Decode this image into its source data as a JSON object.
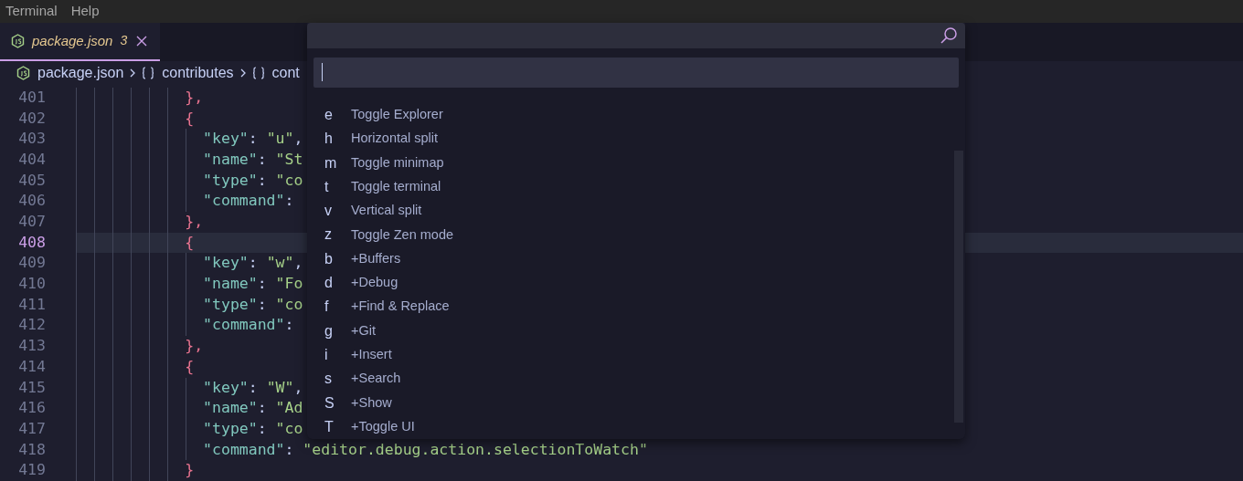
{
  "menu_bar": [
    "Terminal",
    "Help"
  ],
  "tabs": [
    {
      "label": "package.json",
      "badge": "3",
      "selected": true
    }
  ],
  "breadcrumb": [
    "package.json",
    "contributes",
    "cont"
  ],
  "code_lines": [
    {
      "number": "401",
      "selected": false,
      "tokens": [
        {
          "text": "            },",
          "kind": "punct"
        }
      ]
    },
    {
      "number": "402",
      "selected": false,
      "tokens": [
        {
          "text": "            {",
          "kind": "punct"
        }
      ]
    },
    {
      "number": "403",
      "selected": false,
      "tokens": [
        {
          "text": "              \"key\"",
          "kind": "key"
        },
        {
          "text": ": ",
          "kind": "plain"
        },
        {
          "text": "\"u\"",
          "kind": "string"
        },
        {
          "text": ",",
          "kind": "plain"
        }
      ]
    },
    {
      "number": "404",
      "selected": false,
      "tokens": [
        {
          "text": "              \"name\"",
          "kind": "key"
        },
        {
          "text": ": ",
          "kind": "plain"
        },
        {
          "text": "\"St",
          "kind": "string"
        }
      ]
    },
    {
      "number": "405",
      "selected": false,
      "tokens": [
        {
          "text": "              \"type\"",
          "kind": "key"
        },
        {
          "text": ": ",
          "kind": "plain"
        },
        {
          "text": "\"co",
          "kind": "string"
        }
      ]
    },
    {
      "number": "406",
      "selected": false,
      "tokens": [
        {
          "text": "              \"command\"",
          "kind": "key"
        },
        {
          "text": ":",
          "kind": "plain"
        }
      ]
    },
    {
      "number": "407",
      "selected": false,
      "tokens": [
        {
          "text": "            },",
          "kind": "punct"
        }
      ]
    },
    {
      "number": "408",
      "selected": true,
      "tokens": [
        {
          "text": "            {",
          "kind": "punct"
        }
      ]
    },
    {
      "number": "409",
      "selected": false,
      "tokens": [
        {
          "text": "              \"key\"",
          "kind": "key"
        },
        {
          "text": ": ",
          "kind": "plain"
        },
        {
          "text": "\"w\"",
          "kind": "string"
        },
        {
          "text": ",",
          "kind": "plain"
        }
      ]
    },
    {
      "number": "410",
      "selected": false,
      "tokens": [
        {
          "text": "              \"name\"",
          "kind": "key"
        },
        {
          "text": ": ",
          "kind": "plain"
        },
        {
          "text": "\"Fo",
          "kind": "string"
        }
      ]
    },
    {
      "number": "411",
      "selected": false,
      "tokens": [
        {
          "text": "              \"type\"",
          "kind": "key"
        },
        {
          "text": ": ",
          "kind": "plain"
        },
        {
          "text": "\"co",
          "kind": "string"
        }
      ]
    },
    {
      "number": "412",
      "selected": false,
      "tokens": [
        {
          "text": "              \"command\"",
          "kind": "key"
        },
        {
          "text": ":",
          "kind": "plain"
        }
      ]
    },
    {
      "number": "413",
      "selected": false,
      "tokens": [
        {
          "text": "            },",
          "kind": "punct"
        }
      ]
    },
    {
      "number": "414",
      "selected": false,
      "tokens": [
        {
          "text": "            {",
          "kind": "punct"
        }
      ]
    },
    {
      "number": "415",
      "selected": false,
      "tokens": [
        {
          "text": "              \"key\"",
          "kind": "key"
        },
        {
          "text": ": ",
          "kind": "plain"
        },
        {
          "text": "\"W\"",
          "kind": "string"
        },
        {
          "text": ",",
          "kind": "plain"
        }
      ]
    },
    {
      "number": "416",
      "selected": false,
      "tokens": [
        {
          "text": "              \"name\"",
          "kind": "key"
        },
        {
          "text": ": ",
          "kind": "plain"
        },
        {
          "text": "\"Ad",
          "kind": "string"
        }
      ]
    },
    {
      "number": "417",
      "selected": false,
      "tokens": [
        {
          "text": "              \"type\"",
          "kind": "key"
        },
        {
          "text": ": ",
          "kind": "plain"
        },
        {
          "text": "\"co",
          "kind": "string"
        }
      ]
    },
    {
      "number": "418",
      "selected": false,
      "tokens": [
        {
          "text": "              \"command\"",
          "kind": "key"
        },
        {
          "text": ": ",
          "kind": "plain"
        },
        {
          "text": "\"editor.debug.action.selectionToWatch\"",
          "kind": "string"
        }
      ]
    },
    {
      "number": "419",
      "selected": false,
      "tokens": [
        {
          "text": "            }",
          "kind": "punct"
        }
      ]
    }
  ],
  "quick_pick": {
    "items": [
      {
        "key": "e",
        "label": "Toggle Explorer"
      },
      {
        "key": "h",
        "label": "Horizontal split"
      },
      {
        "key": "m",
        "label": "Toggle minimap"
      },
      {
        "key": "t",
        "label": "Toggle terminal"
      },
      {
        "key": "v",
        "label": "Vertical split"
      },
      {
        "key": "z",
        "label": "Toggle Zen mode"
      },
      {
        "key": "b",
        "label": "+Buffers"
      },
      {
        "key": "d",
        "label": "+Debug"
      },
      {
        "key": "f",
        "label": "+Find & Replace"
      },
      {
        "key": "g",
        "label": "+Git"
      },
      {
        "key": "i",
        "label": "+Insert"
      },
      {
        "key": "s",
        "label": "+Search"
      },
      {
        "key": "S",
        "label": "+Show"
      },
      {
        "key": "T",
        "label": "+Toggle UI"
      }
    ]
  }
}
